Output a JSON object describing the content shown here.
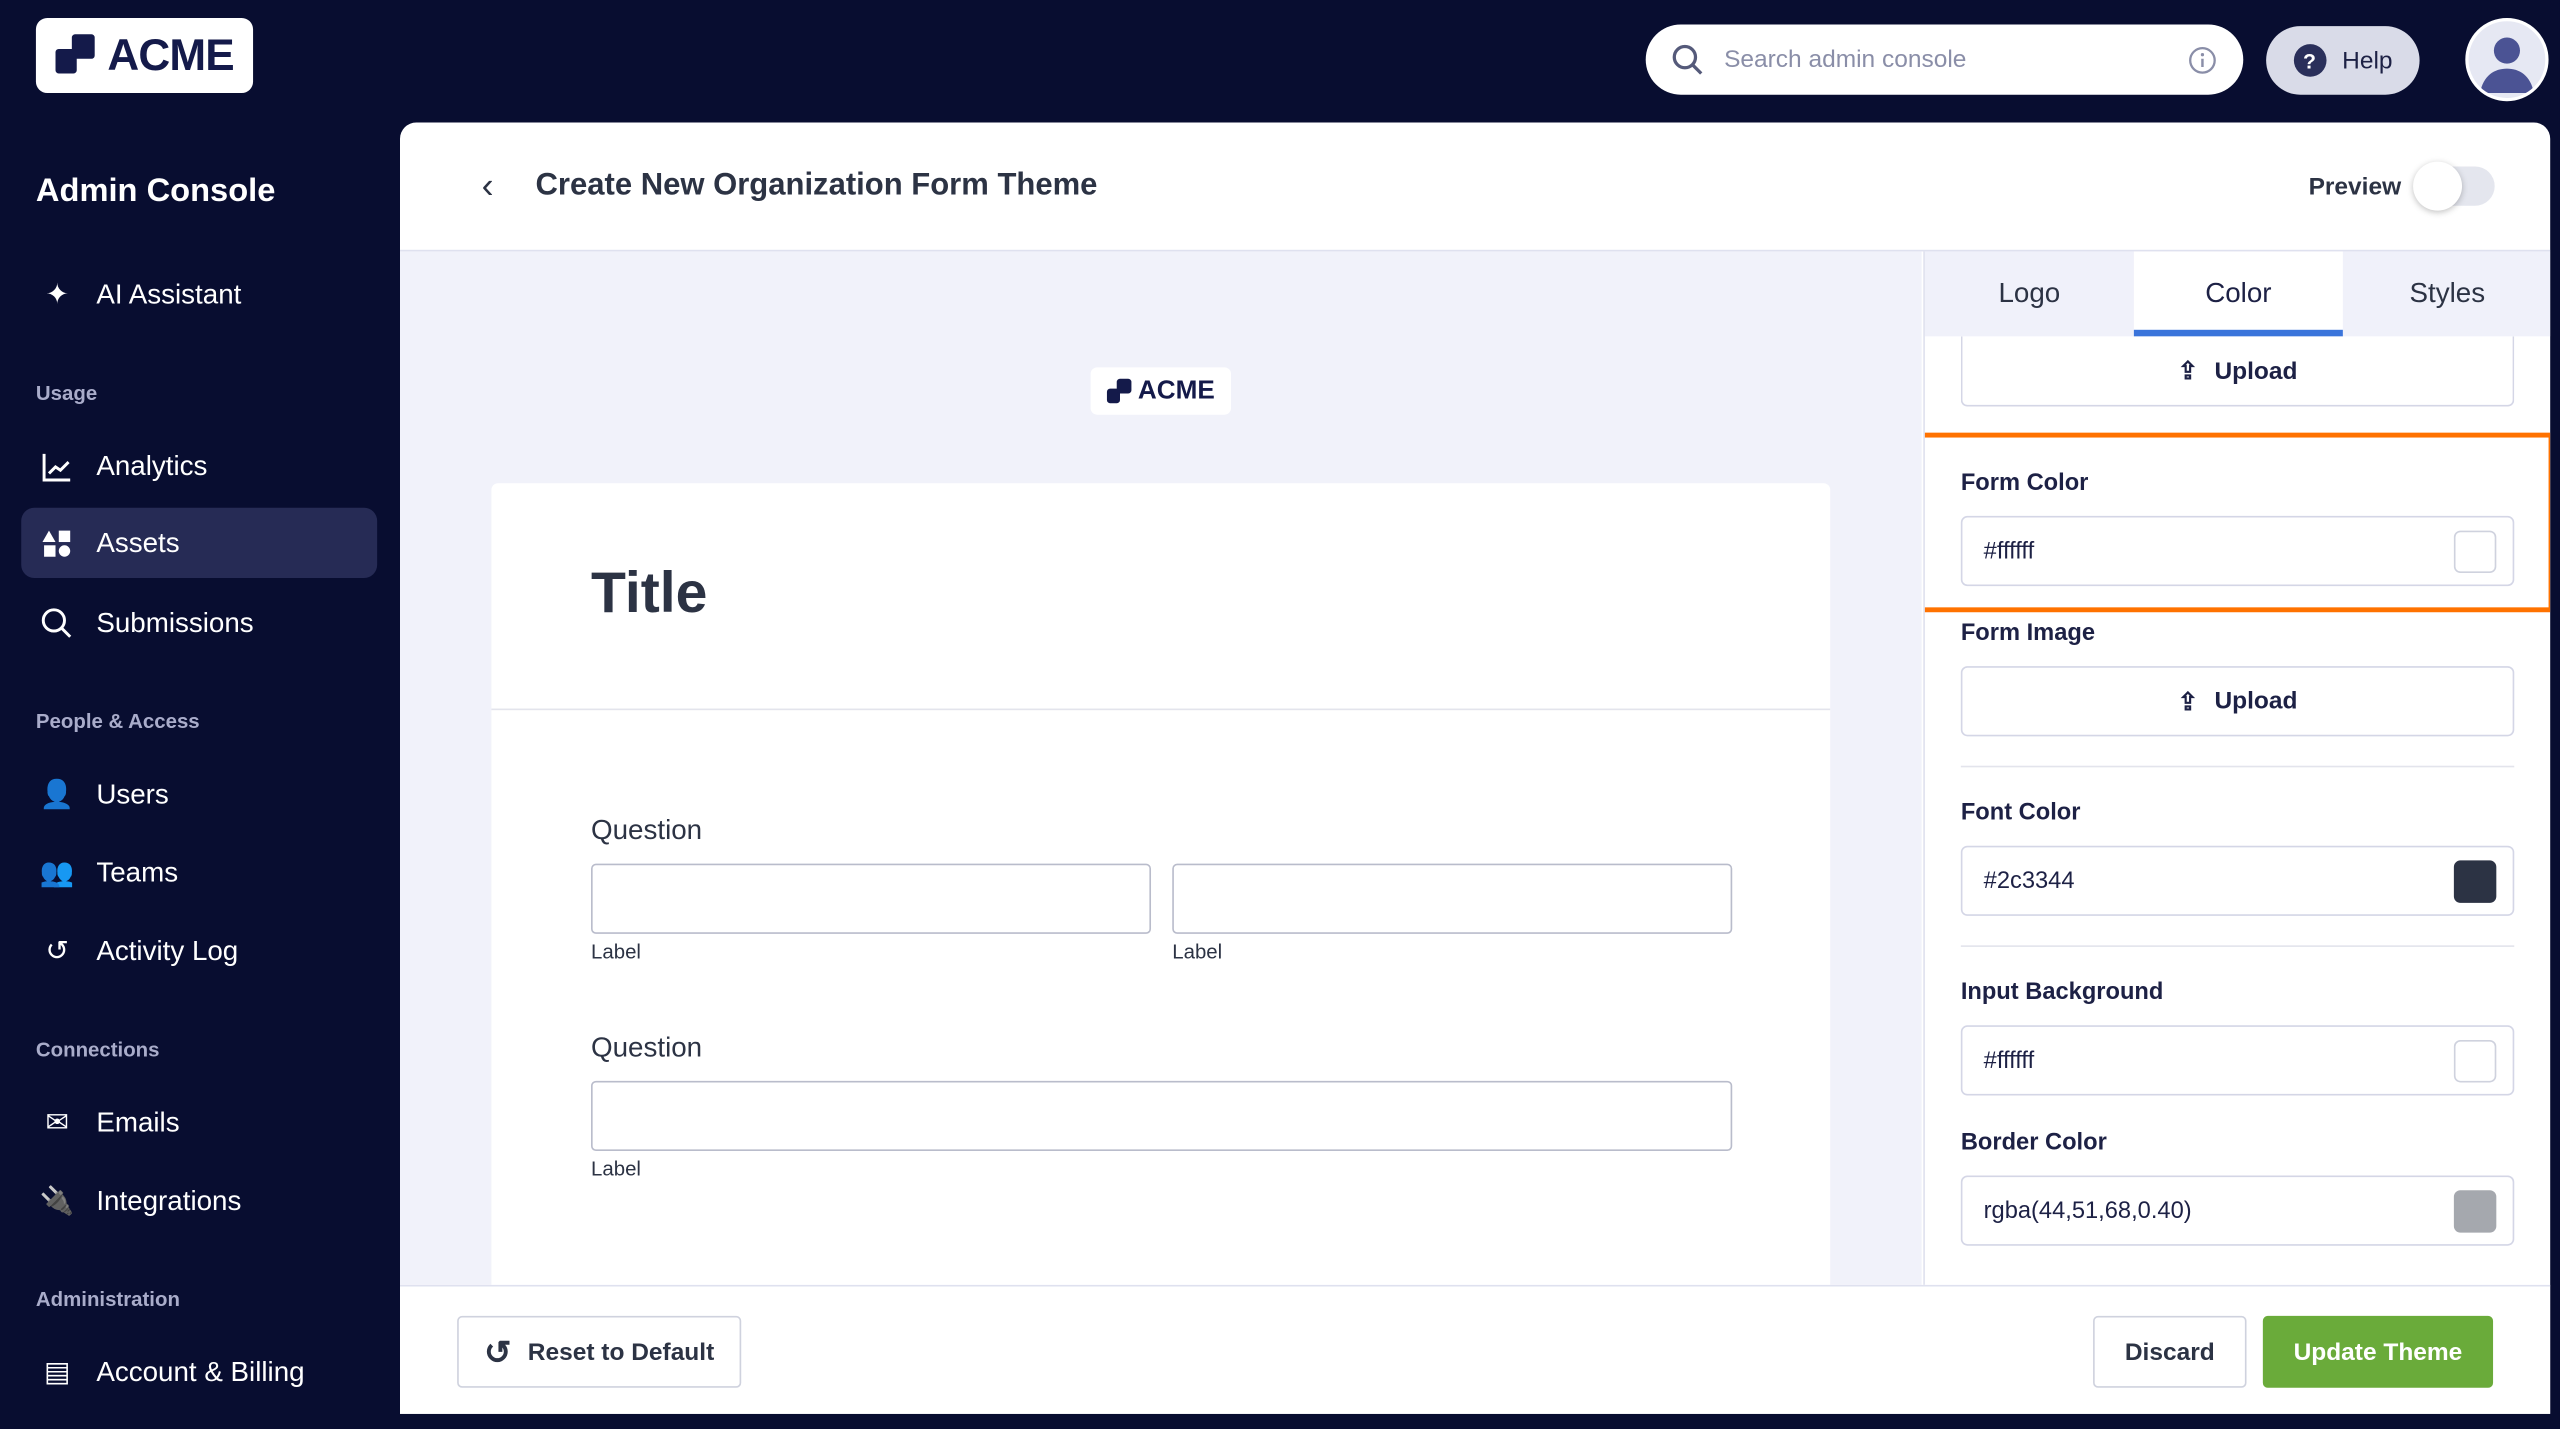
{
  "brand": {
    "logo_text": "ACME"
  },
  "topbar": {
    "search_placeholder": "Search admin console",
    "help_label": "Help"
  },
  "sidebar": {
    "title": "Admin Console",
    "ai_assistant": "AI Assistant",
    "sections": [
      {
        "heading": "Usage",
        "items": [
          "Analytics",
          "Assets",
          "Submissions"
        ]
      },
      {
        "heading": "People & Access",
        "items": [
          "Users",
          "Teams",
          "Activity Log"
        ]
      },
      {
        "heading": "Connections",
        "items": [
          "Emails",
          "Integrations"
        ]
      },
      {
        "heading": "Administration",
        "items": [
          "Account & Billing"
        ]
      }
    ],
    "active": "Assets"
  },
  "header": {
    "title": "Create New Organization Form Theme",
    "preview_label": "Preview",
    "preview_on": false
  },
  "preview": {
    "logo_text": "ACME",
    "form_title": "Title",
    "question1": "Question",
    "question2": "Question",
    "label": "Label"
  },
  "panel": {
    "tabs": [
      "Logo",
      "Color",
      "Styles"
    ],
    "active_tab": "Color",
    "upload_label": "Upload",
    "form_color": {
      "label": "Form Color",
      "value": "#ffffff",
      "swatch": "#ffffff"
    },
    "form_image": {
      "label": "Form Image",
      "upload": "Upload"
    },
    "font_color": {
      "label": "Font Color",
      "value": "#2c3344",
      "swatch": "#2c3344"
    },
    "input_background": {
      "label": "Input Background",
      "value": "#ffffff",
      "swatch": "#ffffff"
    },
    "border_color": {
      "label": "Border Color",
      "value": "rgba(44,51,68,0.40)",
      "swatch": "#a5a8ae"
    }
  },
  "footer": {
    "reset": "Reset to Default",
    "discard": "Discard",
    "update": "Update Theme"
  },
  "colors": {
    "highlight": "#ff7200",
    "accent": "#3a74db",
    "primary_button": "#6aab3a"
  }
}
